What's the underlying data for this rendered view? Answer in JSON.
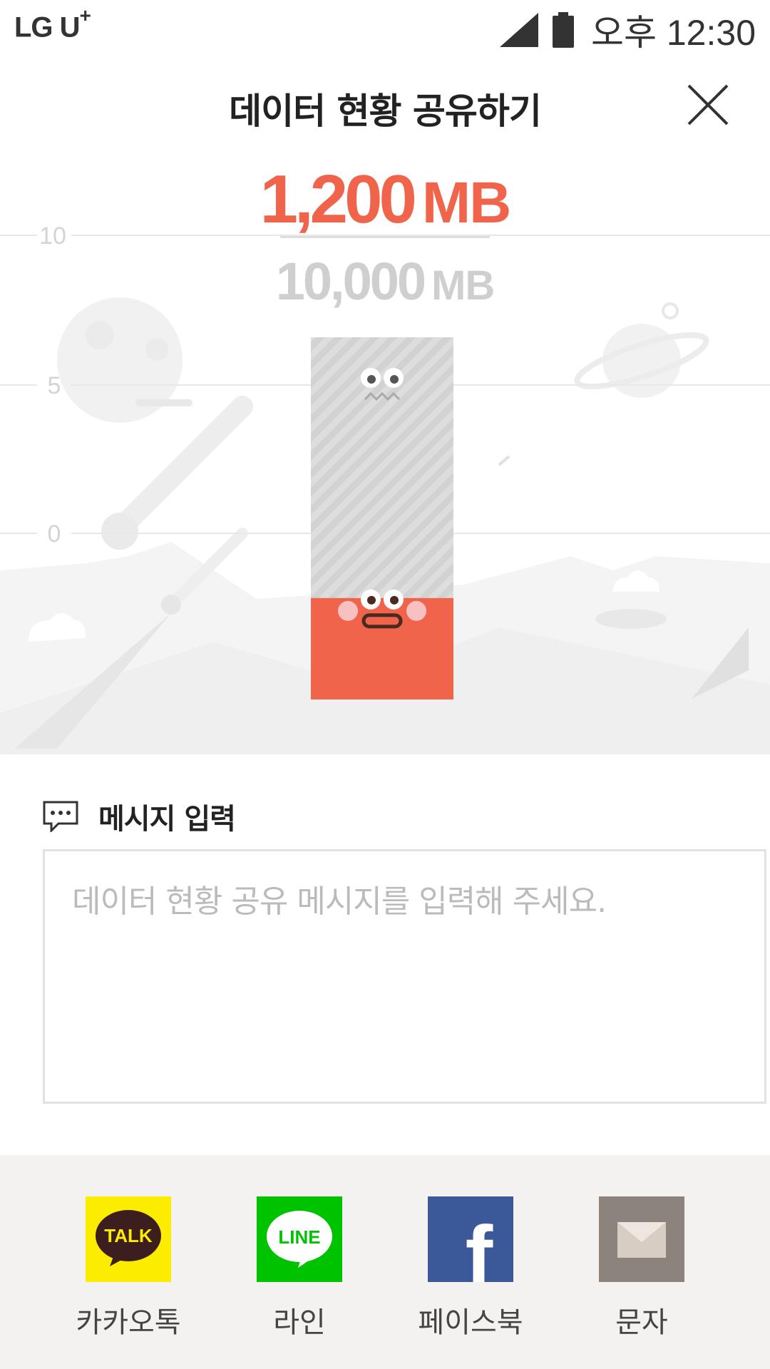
{
  "status_bar": {
    "carrier": "LG U",
    "carrier_plus": "+",
    "time": "오후 12:30",
    "icons": [
      "signal-icon",
      "battery-icon"
    ]
  },
  "header": {
    "title": "데이터 현황 공유하기",
    "close_icon": "close-icon"
  },
  "data_usage": {
    "used_value": "1,200",
    "used_unit": "MB",
    "total_value": "10,000",
    "total_unit": "MB",
    "used_fraction": 0.12
  },
  "chart_data": {
    "type": "bar",
    "y_ticks": [
      "10",
      "5",
      "0"
    ],
    "used_mb": 1200,
    "total_mb": 10000
  },
  "message": {
    "label": "메시지 입력",
    "icon": "speech-bubble-icon",
    "placeholder": "데이터 현황 공유 메시지를 입력해 주세요."
  },
  "share": {
    "items": [
      {
        "label": "카카오톡",
        "icon": "kakaotalk-icon",
        "icon_text": "TALK",
        "color": "#fcec00"
      },
      {
        "label": "라인",
        "icon": "line-icon",
        "icon_text": "LINE",
        "color": "#00c300"
      },
      {
        "label": "페이스북",
        "icon": "facebook-icon",
        "icon_text": "f",
        "color": "#3b5998"
      },
      {
        "label": "문자",
        "icon": "envelope-icon",
        "color": "#8c837d"
      }
    ]
  },
  "colors": {
    "accent": "#ef644a",
    "muted": "#cfcfcf"
  }
}
